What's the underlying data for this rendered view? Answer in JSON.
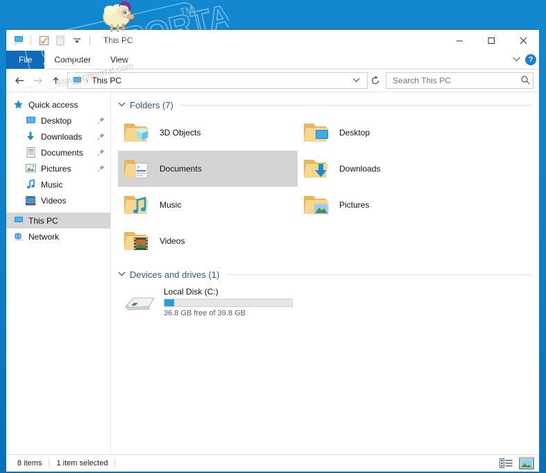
{
  "window": {
    "title": "This PC",
    "quick_access_toolbar": [
      {
        "name": "this-pc-icon",
        "label": "This PC"
      },
      {
        "name": "properties-icon",
        "label": "Properties"
      },
      {
        "name": "new-folder-icon",
        "label": "New folder"
      },
      {
        "name": "customize-dropdown-icon",
        "label": "Customize Quick Access Toolbar"
      }
    ],
    "controls": {
      "minimize": "—",
      "maximize": "□",
      "close": "✕",
      "ribbon_toggle": "⌄",
      "help": "?"
    }
  },
  "ribbon": {
    "tabs": [
      {
        "label": "File",
        "active": true
      },
      {
        "label": "Computer",
        "active": false
      },
      {
        "label": "View",
        "active": false
      }
    ]
  },
  "address": {
    "back": "←",
    "forward": "→",
    "up": "↑",
    "crumb_icon": "this-pc-icon",
    "crumb_separator": "›",
    "path": "This PC",
    "dropdown": "⌄",
    "refresh": "↻"
  },
  "search": {
    "placeholder": "Search This PC",
    "value": "",
    "icon": "search-icon"
  },
  "sidebar": {
    "items": [
      {
        "label": "Quick access",
        "icon": "star-icon",
        "indent": false,
        "pinned": false,
        "selected": false
      },
      {
        "label": "Desktop",
        "icon": "desktop-icon",
        "indent": true,
        "pinned": true,
        "selected": false
      },
      {
        "label": "Downloads",
        "icon": "downloads-icon",
        "indent": true,
        "pinned": true,
        "selected": false
      },
      {
        "label": "Documents",
        "icon": "documents-icon",
        "indent": true,
        "pinned": true,
        "selected": false
      },
      {
        "label": "Pictures",
        "icon": "pictures-icon",
        "indent": true,
        "pinned": true,
        "selected": false
      },
      {
        "label": "Music",
        "icon": "music-icon",
        "indent": true,
        "pinned": false,
        "selected": false
      },
      {
        "label": "Videos",
        "icon": "videos-icon",
        "indent": true,
        "pinned": false,
        "selected": false
      },
      {
        "label": "This PC",
        "icon": "this-pc-icon",
        "indent": false,
        "pinned": false,
        "selected": true
      },
      {
        "label": "Network",
        "icon": "network-icon",
        "indent": false,
        "pinned": false,
        "selected": false
      }
    ],
    "pin_glyph": "📌"
  },
  "main": {
    "groups": [
      {
        "title": "Folders (7)",
        "collapse_glyph": "⌄",
        "items": [
          {
            "label": "3D Objects",
            "icon": "folder-3d-objects-icon",
            "selected": false
          },
          {
            "label": "Desktop",
            "icon": "folder-desktop-icon",
            "selected": false
          },
          {
            "label": "Documents",
            "icon": "folder-documents-icon",
            "selected": true
          },
          {
            "label": "Downloads",
            "icon": "folder-downloads-icon",
            "selected": false
          },
          {
            "label": "Music",
            "icon": "folder-music-icon",
            "selected": false
          },
          {
            "label": "Pictures",
            "icon": "folder-pictures-icon",
            "selected": false
          },
          {
            "label": "Videos",
            "icon": "folder-videos-icon",
            "selected": false
          }
        ]
      },
      {
        "title": "Devices and drives (1)",
        "collapse_glyph": "⌄",
        "drive": {
          "name": "Local Disk (C:)",
          "icon": "hard-drive-icon",
          "capacity_text": "36.8 GB free of 39.8 GB",
          "used_percent": 7.5,
          "bar_color": "#26a0da"
        }
      }
    ]
  },
  "statusbar": {
    "item_count": "8 items",
    "selection": "1 item selected",
    "views": [
      {
        "name": "details-view-icon",
        "active": false
      },
      {
        "name": "large-icons-view-icon",
        "active": true
      }
    ]
  },
  "watermark": {
    "text": "SOFTPORTAL",
    "trademark": "TM",
    "url": "www.softportal.com"
  },
  "colors": {
    "accent": "#0f6cbd",
    "selection": "#d4d4d4",
    "group_header": "#2b5797",
    "folder": "#f5cf82",
    "desktop": "#0f7ec6"
  }
}
